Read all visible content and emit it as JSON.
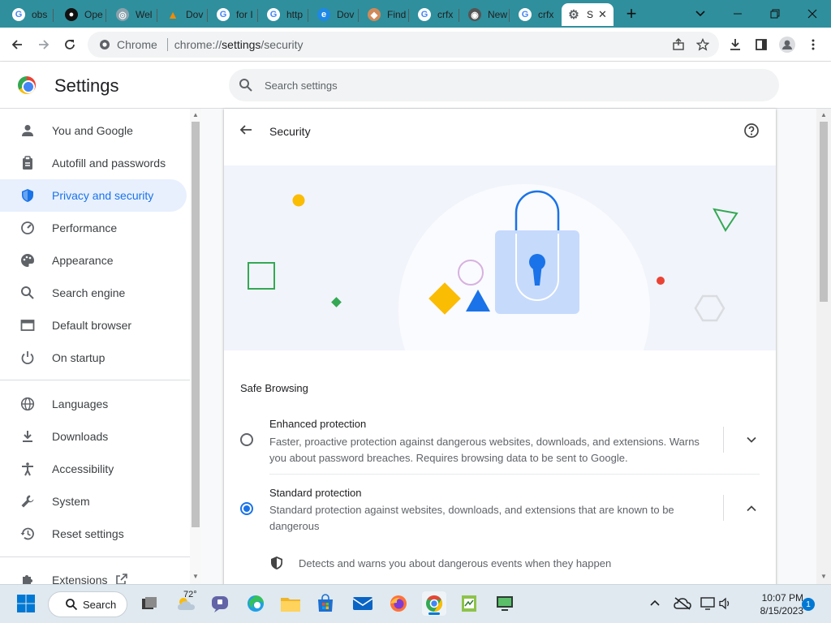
{
  "tabs": [
    {
      "title": "obs",
      "icon": "google-g-icon"
    },
    {
      "title": "Ope",
      "icon": "github-icon"
    },
    {
      "title": "Wel",
      "icon": "globe-icon"
    },
    {
      "title": "Dov",
      "icon": "vlc-icon"
    },
    {
      "title": "for I",
      "icon": "google-g-icon"
    },
    {
      "title": "http",
      "icon": "google-g-icon"
    },
    {
      "title": "Dov",
      "icon": "edge-icon"
    },
    {
      "title": "Find",
      "icon": "chrome-webstore-icon"
    },
    {
      "title": "crfx",
      "icon": "google-g-icon"
    },
    {
      "title": "New",
      "icon": "chrome-icon"
    },
    {
      "title": "crfx",
      "icon": "google-g-icon"
    },
    {
      "title": "S",
      "icon": "gear-icon"
    }
  ],
  "omnibox": {
    "site": "Chrome",
    "url_scheme": "chrome://",
    "url_host": "settings",
    "url_path": "/security"
  },
  "header": {
    "title": "Settings",
    "search_placeholder": "Search settings"
  },
  "sidebar": {
    "items": [
      {
        "label": "You and Google",
        "icon": "person-icon"
      },
      {
        "label": "Autofill and passwords",
        "icon": "clipboard-icon"
      },
      {
        "label": "Privacy and security",
        "icon": "shield-icon",
        "selected": true
      },
      {
        "label": "Performance",
        "icon": "speedometer-icon"
      },
      {
        "label": "Appearance",
        "icon": "palette-icon"
      },
      {
        "label": "Search engine",
        "icon": "search-icon"
      },
      {
        "label": "Default browser",
        "icon": "browser-window-icon"
      },
      {
        "label": "On startup",
        "icon": "power-icon"
      },
      {
        "label": "Languages",
        "icon": "globe-icon"
      },
      {
        "label": "Downloads",
        "icon": "download-icon"
      },
      {
        "label": "Accessibility",
        "icon": "accessibility-icon"
      },
      {
        "label": "System",
        "icon": "wrench-icon"
      },
      {
        "label": "Reset settings",
        "icon": "history-icon"
      },
      {
        "label": "Extensions",
        "icon": "puzzle-icon"
      }
    ]
  },
  "page": {
    "title": "Security",
    "section_title": "Safe Browsing",
    "options": [
      {
        "title": "Enhanced protection",
        "desc": "Faster, proactive protection against dangerous websites, downloads, and extensions. Warns you about password breaches. Requires browsing data to be sent to Google.",
        "selected": false
      },
      {
        "title": "Standard protection",
        "desc": "Standard protection against websites, downloads, and extensions that are known to be dangerous",
        "selected": true
      }
    ],
    "detail": "Detects and warns you about dangerous events when they happen"
  },
  "taskbar": {
    "search_label": "Search",
    "weather": "72°",
    "time": "10:07 PM",
    "date": "8/15/2023",
    "notification_count": "1"
  },
  "colors": {
    "tabbar": "#2f8f9d",
    "accent": "#1a73e8",
    "selected_nav": "#e8f0fe",
    "taskbar": "#dfe9ef"
  }
}
